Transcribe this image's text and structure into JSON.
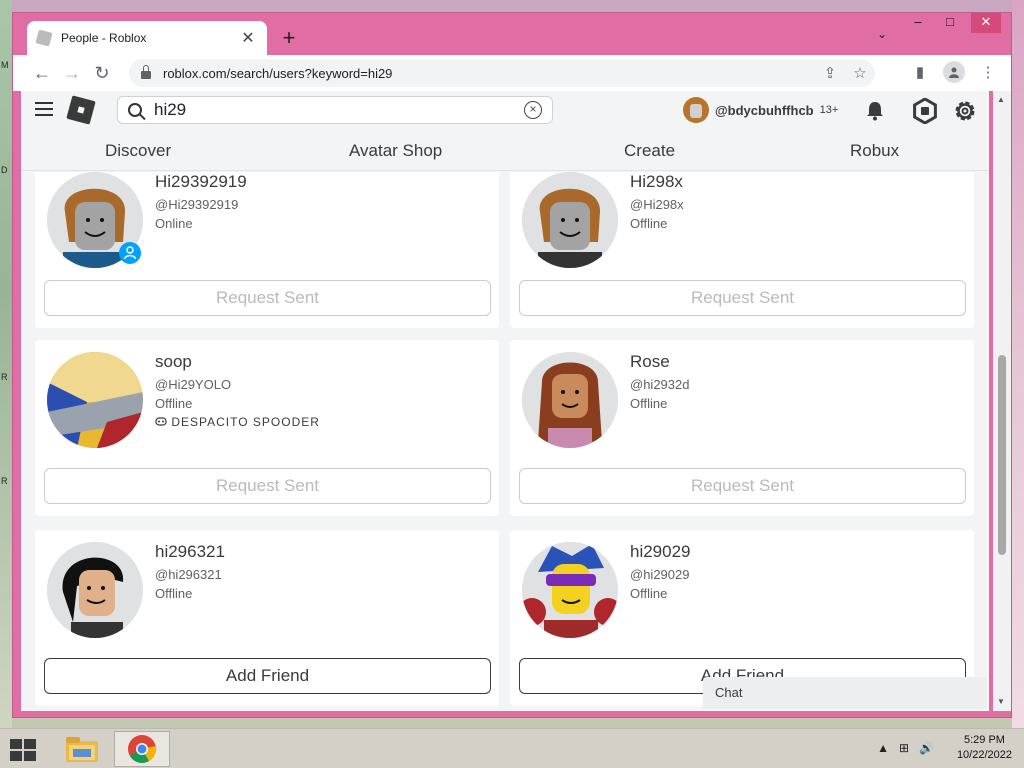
{
  "desktop": {
    "edge_letters": [
      "M",
      "D",
      "R",
      "R"
    ]
  },
  "browser": {
    "tab_title": "People - Roblox",
    "tab_close": "✕",
    "new_tab": "+",
    "tab_search": "⌄",
    "window_controls": {
      "minimize": "‒",
      "maximize": "□",
      "close": "✕"
    },
    "nav": {
      "back": "←",
      "forward": "→",
      "reload": "↻"
    },
    "url": "roblox.com/search/users?keyword=hi29",
    "omnibox_icons": {
      "share": "⇪",
      "bookmark": "☆"
    },
    "right_icons": {
      "sidepanel": "▮",
      "menu": "⋮"
    }
  },
  "roblox": {
    "search": {
      "value": "hi29",
      "clear": "×"
    },
    "user": {
      "username": "@bdycbuhffhcb",
      "age_badge": "13+"
    },
    "nav": [
      "Discover",
      "Avatar Shop",
      "Create",
      "Robux"
    ],
    "cards": [
      {
        "name": "Hi29392919",
        "handle": "@Hi29392919",
        "status": "Online",
        "extra": "",
        "button": "Request Sent",
        "button_state": "sent"
      },
      {
        "name": "Hi298x",
        "handle": "@Hi298x",
        "status": "Offline",
        "extra": "",
        "button": "Request Sent",
        "button_state": "sent"
      },
      {
        "name": "soop",
        "handle": "@Hi29YOLO",
        "status": "Offline",
        "extra": "DESPACITO SPOODER",
        "button": "Request Sent",
        "button_state": "sent"
      },
      {
        "name": "Rose",
        "handle": "@hi2932d",
        "status": "Offline",
        "extra": "",
        "button": "Request Sent",
        "button_state": "sent"
      },
      {
        "name": "hi296321",
        "handle": "@hi296321",
        "status": "Offline",
        "extra": "",
        "button": "Add Friend",
        "button_state": "add"
      },
      {
        "name": "hi29029",
        "handle": "@hi29029",
        "status": "Offline",
        "extra": "",
        "button": "Add Friend",
        "button_state": "add"
      }
    ],
    "chat_label": "Chat"
  },
  "taskbar": {
    "time": "5:29 PM",
    "date": "10/22/2022",
    "tray_icons": [
      "▲",
      "⊞",
      "🔊"
    ]
  },
  "colors": {
    "window_frame": "#e06ea5",
    "page_bg": "#f2f4f5",
    "online_badge": "#00a2ff"
  }
}
